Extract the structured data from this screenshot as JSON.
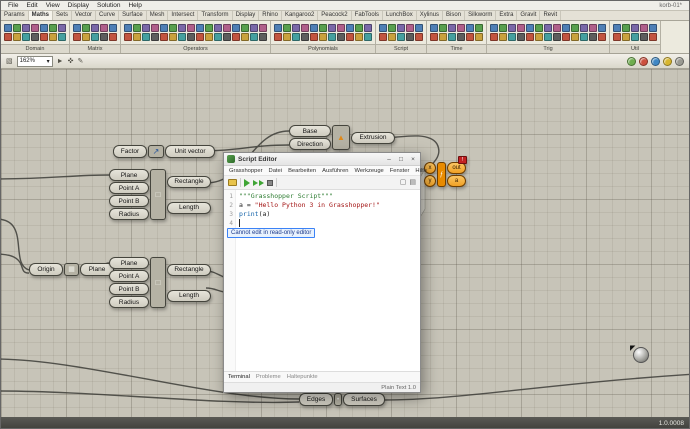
{
  "window": {
    "title": "korb-01*"
  },
  "menubar": {
    "items": [
      "File",
      "Edit",
      "View",
      "Display",
      "Solution",
      "Help"
    ]
  },
  "tabs": {
    "active": "Maths",
    "items": [
      "Params",
      "Maths",
      "Sets",
      "Vector",
      "Curve",
      "Surface",
      "Mesh",
      "Intersect",
      "Transform",
      "Display",
      "Rhino",
      "Kangaroo2",
      "Peacock2",
      "FabTools",
      "LunchBox",
      "Xylinus",
      "Bison",
      "Silkworm",
      "Extra",
      "Gravit",
      "Revit"
    ]
  },
  "ribbon": {
    "palette": [
      "#4e7fb5",
      "#c2543f",
      "#58a04e",
      "#c9a23d",
      "#7a68a8",
      "#45a0a0",
      "#b05f8a",
      "#5d5d5d"
    ],
    "groups": [
      {
        "label": "Domain",
        "icons": 14
      },
      {
        "label": "Matrix",
        "icons": 10
      },
      {
        "label": "Operators",
        "icons": 32
      },
      {
        "label": "Polynomials",
        "icons": 22
      },
      {
        "label": "Script",
        "icons": 10
      },
      {
        "label": "Time",
        "icons": 12
      },
      {
        "label": "Trig",
        "icons": 26
      },
      {
        "label": "Util",
        "icons": 10
      }
    ]
  },
  "canvas_toolbar": {
    "zoom": "162%",
    "balls": [
      "#6fae4e",
      "#cc4f3d",
      "#3f87c4",
      "#d8b62d",
      "#9a9a92"
    ]
  },
  "components": {
    "unit_vector": {
      "input": "Factor",
      "label": "Unit vector",
      "icon": "↗"
    },
    "extrusion": {
      "inputs": [
        "Base",
        "Direction"
      ],
      "output": "Extrusion",
      "icon": "▲"
    },
    "rect1": {
      "inputs": [
        "Plane",
        "Point A",
        "Point B",
        "Radius"
      ],
      "outputs": [
        "Rectangle",
        "Length"
      ],
      "icon": "□"
    },
    "plane": {
      "input": "Origin",
      "output": "Plane",
      "icon": "▦"
    },
    "rect2": {
      "inputs": [
        "Plane",
        "Point A",
        "Point B",
        "Radius"
      ],
      "outputs": [
        "Rectangle",
        "Length"
      ],
      "icon": "□"
    },
    "script": {
      "inputs": [
        "x",
        "y"
      ],
      "outputs": [
        "out",
        "a"
      ],
      "icon": "ƒ",
      "badge": "!"
    },
    "edges_surfaces": {
      "left": "Edges",
      "right": "Surfaces",
      "icon": "•"
    }
  },
  "editor": {
    "title": "Script Editor",
    "window_buttons": [
      "–",
      "□",
      "×"
    ],
    "menus": [
      "Grasshopper",
      "Datei",
      "Bearbeiten",
      "Ausführen",
      "Werkzeuge",
      "Fenster",
      "Hilfe"
    ],
    "code_lines": [
      {
        "n": "1",
        "segs": [
          {
            "t": "\"\"\"Grasshopper Script\"\"\"",
            "c": "s1"
          }
        ]
      },
      {
        "n": "2",
        "segs": [
          {
            "t": "a = ",
            "c": "p"
          },
          {
            "t": "\"Hello Python 3 in Grasshopper!\"",
            "c": "s2"
          }
        ]
      },
      {
        "n": "3",
        "segs": [
          {
            "t": "print",
            "c": "fn"
          },
          {
            "t": "(a)",
            "c": "p"
          }
        ]
      },
      {
        "n": "4",
        "segs": []
      }
    ],
    "tooltip": "Cannot edit in read-only editor",
    "bottom_tabs": [
      "Terminal",
      "Probleme",
      "Haltepunkte"
    ],
    "status_right": "Plain Text 1.0"
  },
  "statusbar": {
    "version": "1.0.0008"
  }
}
